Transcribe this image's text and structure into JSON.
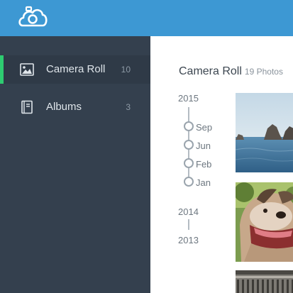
{
  "header": {
    "logo_icon": "camera-cloud-icon",
    "accent": "#3d98d3"
  },
  "sidebar": {
    "items": [
      {
        "label": "Camera Roll",
        "count": "10",
        "icon": "image-icon",
        "active": true
      },
      {
        "label": "Albums",
        "count": "3",
        "icon": "album-book-icon",
        "active": false
      }
    ],
    "active_color": "#2ecc71"
  },
  "main": {
    "title": "Camera Roll",
    "subtitle": "19 Photos",
    "timeline": {
      "years": [
        "2015",
        "2014",
        "2013"
      ],
      "months": [
        "Sep",
        "Jun",
        "Feb",
        "Jan"
      ]
    },
    "photos": [
      {
        "name": "sea-rocks-photo"
      },
      {
        "name": "dog-photo"
      },
      {
        "name": "architecture-photo"
      }
    ]
  }
}
